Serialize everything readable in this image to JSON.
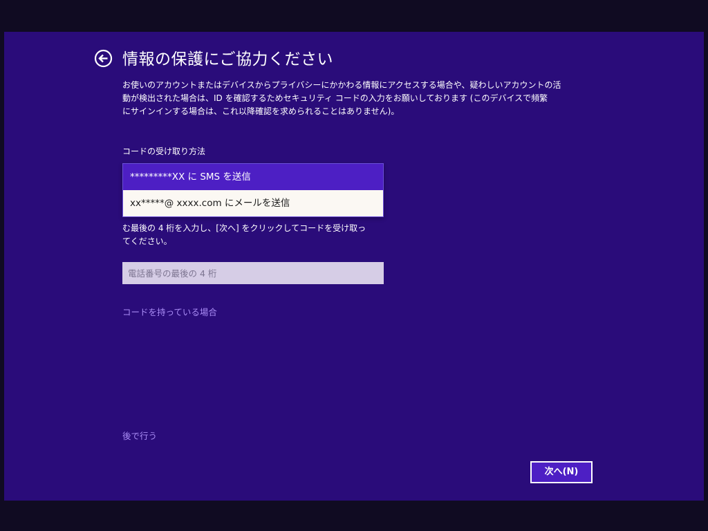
{
  "header": {
    "title": "情報の保護にご協力ください",
    "back_icon": "back-arrow-icon"
  },
  "description": {
    "lines": [
      "お使いのアカウントまたはデバイスからプライバシーにかかわる情報にアクセスする場合や、疑わしいアカウントの活",
      "動が検出された場合は、ID を確認するためセキュリティ コードの入力をお願いしております (このデバイスで頻繁",
      "にサインインする場合は、これ以降確認を求められることはありません)。"
    ]
  },
  "method": {
    "label": "コードの受け取り方法",
    "options": [
      {
        "label": "*********XX に SMS を送信",
        "selected": true
      },
      {
        "label": "xx*****@ xxxx.com にメールを送信",
        "selected": false
      }
    ]
  },
  "instructions": {
    "lines": [
      "む最後の 4 桁を入力し、[次へ] をクリックしてコードを受け取っ",
      "てください。"
    ]
  },
  "phone_input": {
    "value": "",
    "placeholder": "電話番号の最後の 4 桁"
  },
  "links": {
    "have_code": "コードを持っている場合",
    "later": "後で行う"
  },
  "footer": {
    "next_label": "次へ(N)"
  },
  "colors": {
    "background": "#2a0c7a",
    "frame": "#100b22",
    "accent": "#4d1fc4",
    "link": "#a98cf5",
    "input_bg": "#d6cde6"
  }
}
